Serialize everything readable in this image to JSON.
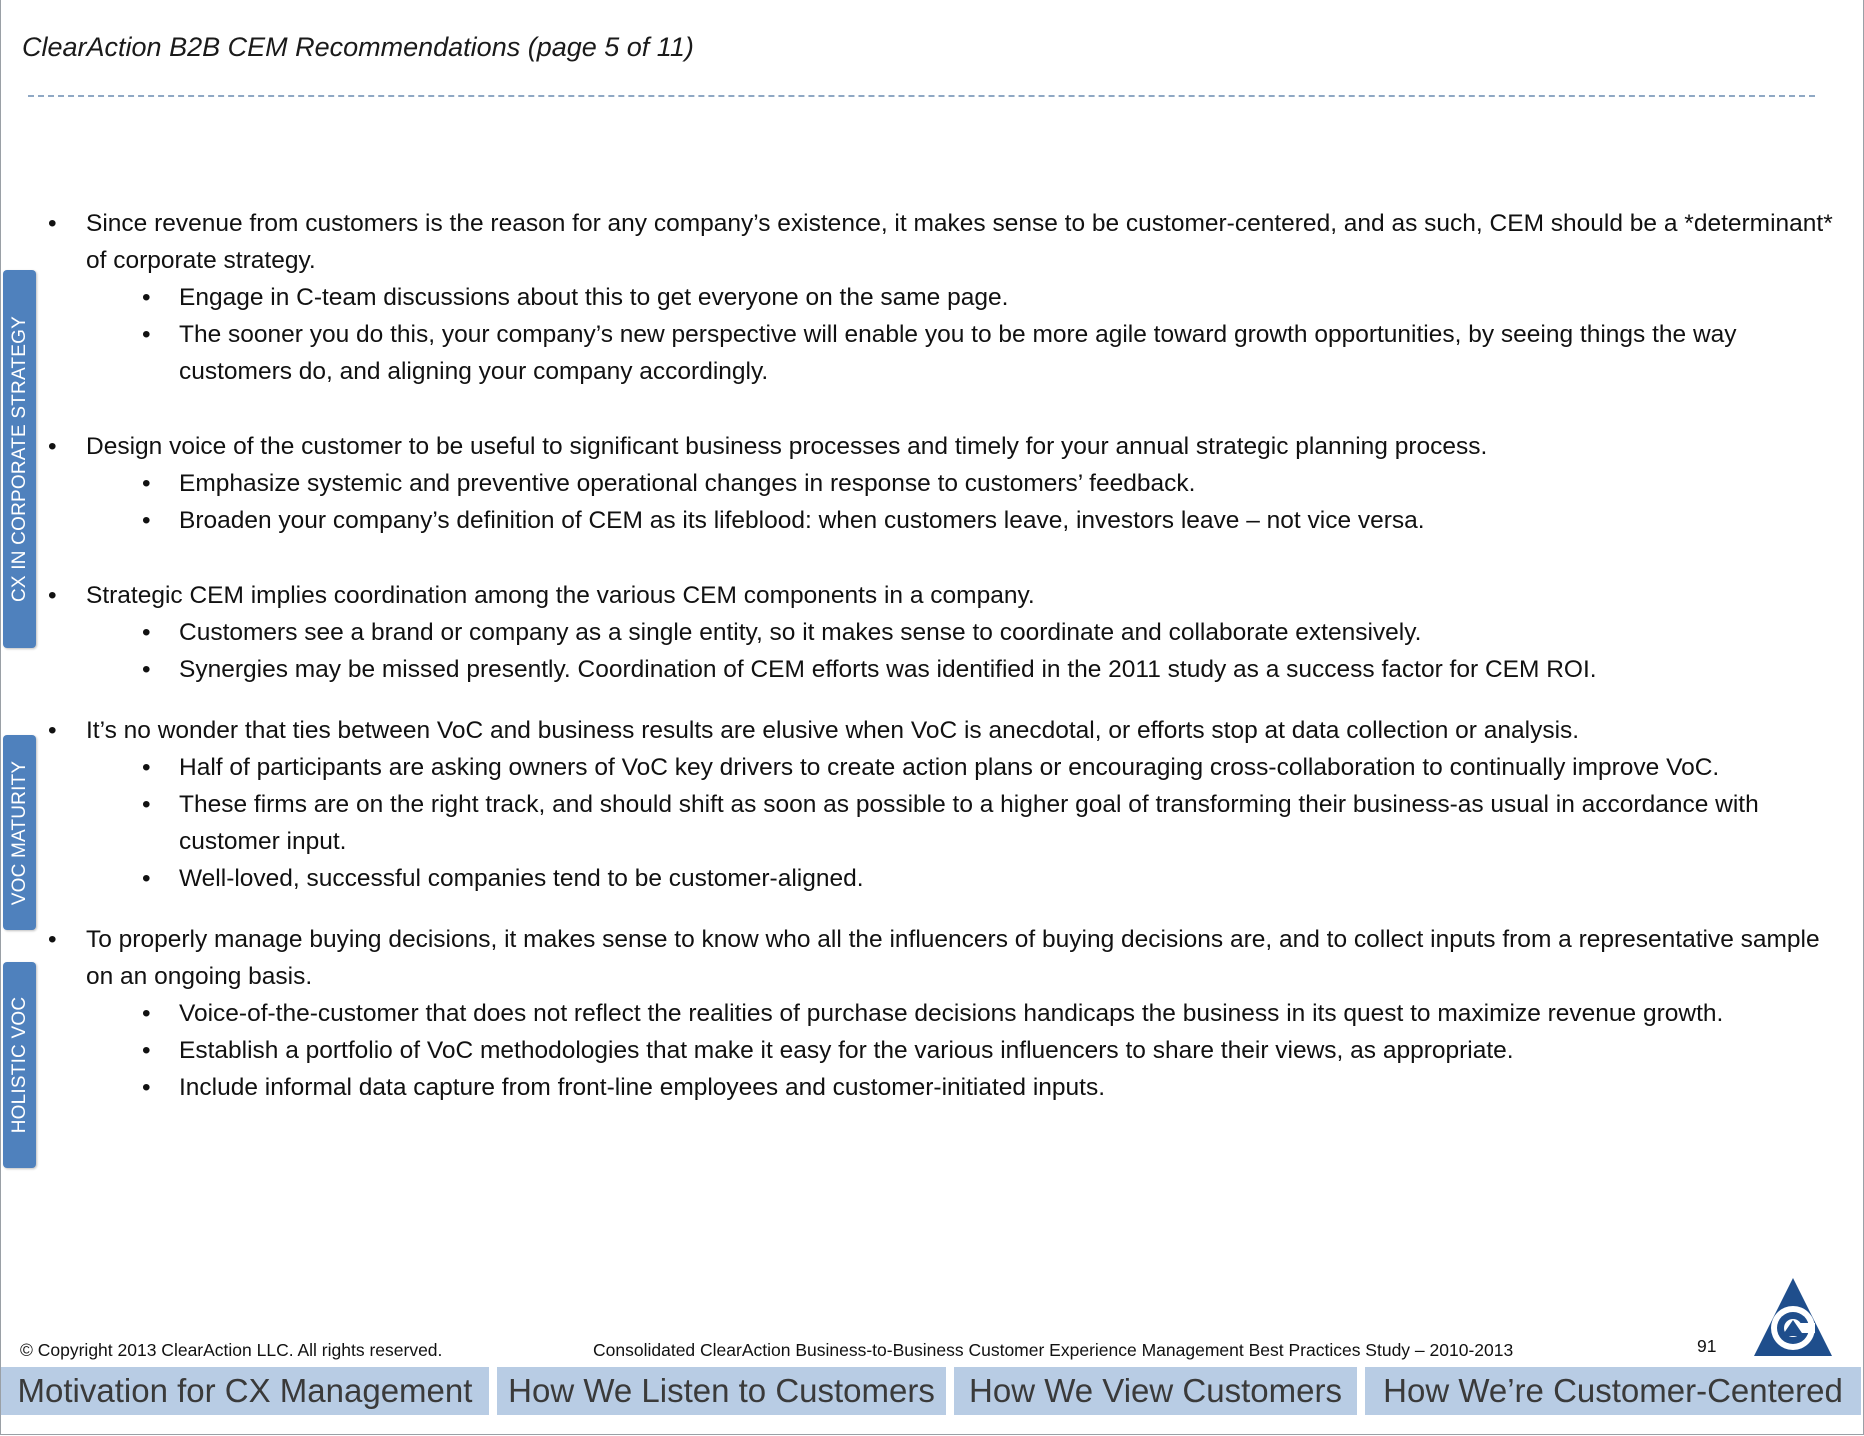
{
  "header": {
    "title": "ClearAction B2B CEM Recommendations  (page 5 of 11)"
  },
  "side_tabs": {
    "cx_strategy": "CX IN CORPORATE STRATEGY",
    "voc_maturity": "VOC MATURITY",
    "holistic_voc": "HOLISTIC VOC"
  },
  "bullets": [
    {
      "text": "Since revenue from customers is the reason for any company’s existence, it makes sense to be customer-centered, and as such, CEM should be a *determinant* of corporate strategy.",
      "sub": [
        "Engage in C-team discussions about this to get everyone on the same page.",
        "The sooner you do this, your company’s new perspective will enable you to be more agile toward growth opportunities, by seeing things the way customers do, and aligning your company accordingly."
      ]
    },
    {
      "text": "Design voice of the customer to be useful to significant business processes and timely for your annual strategic planning process.",
      "sub": [
        "Emphasize systemic and preventive operational changes in response to customers’ feedback.",
        "Broaden your company’s definition of CEM as its lifeblood:  when customers leave, investors leave – not vice versa."
      ]
    },
    {
      "text": "Strategic CEM implies coordination among the various CEM components in a company.",
      "sub": [
        "Customers see a brand or company as a single entity, so it makes sense to coordinate and collaborate extensively.",
        "Synergies may be missed presently. Coordination of CEM efforts was identified in the 2011 study as a success factor for CEM ROI."
      ]
    },
    {
      "text": "It’s no wonder that ties between VoC and business results are elusive when VoC is anecdotal, or efforts stop at data collection or analysis.",
      "sub": [
        "Half of participants are asking owners of VoC key drivers to create action plans or encouraging cross-collaboration to continually improve VoC.",
        "These firms are on the right track, and should shift as soon as possible to a higher goal of transforming their business-as usual in accordance with customer input.",
        "Well-loved, successful companies tend to be customer-aligned."
      ]
    },
    {
      "text": "To properly manage buying decisions, it makes sense to know who all the influencers of buying decisions are, and to collect inputs from a representative sample on an ongoing basis.",
      "sub": [
        "Voice-of-the-customer that does not reflect the realities of purchase decisions handicaps the business in its quest to maximize revenue growth.",
        "Establish a portfolio of VoC methodologies that make it easy for the various influencers to share their views, as appropriate.",
        "Include informal data capture from front-line employees and customer-initiated inputs."
      ]
    }
  ],
  "footer": {
    "copyright": "© Copyright 2013 ClearAction LLC. All rights reserved.",
    "study": "Consolidated ClearAction Business-to-Business Customer Experience Management Best Practices Study – 2010-2013",
    "page_number": "91"
  },
  "nav": [
    "Motivation for CX Management",
    "How We Listen to Customers",
    "How We View Customers",
    "How We’re Customer-Centered"
  ],
  "colors": {
    "tab_blue": "#4f81bd",
    "nav_blue": "#b8cce4",
    "logo_blue": "#1f4e8c"
  },
  "logo_icon": "clearaction-logo"
}
